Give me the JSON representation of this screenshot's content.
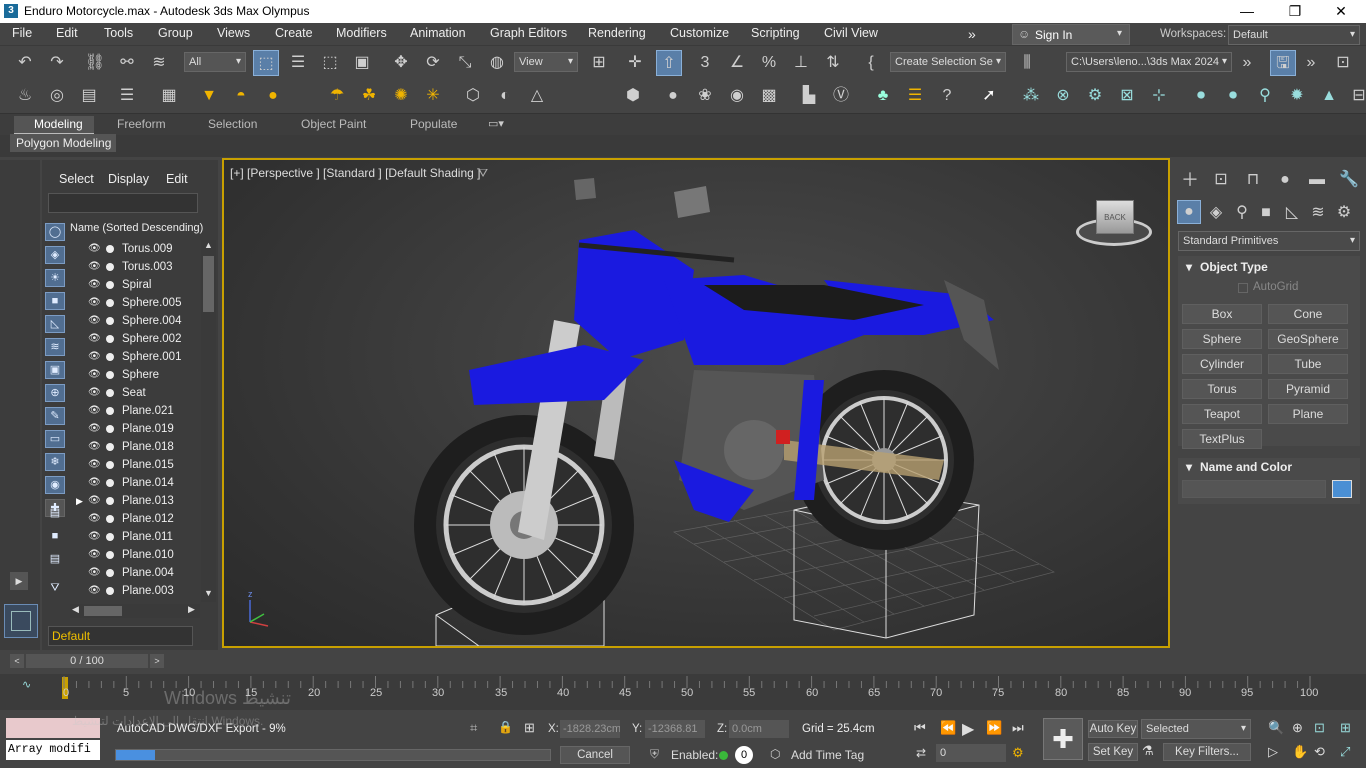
{
  "window": {
    "title": "Enduro Motorcycle.max - Autodesk 3ds Max Olympus",
    "app_icon": "3"
  },
  "menu": [
    "File",
    "Edit",
    "Tools",
    "Group",
    "Views",
    "Create",
    "Modifiers",
    "Animation",
    "Graph Editors",
    "Rendering",
    "Customize",
    "Scripting",
    "Civil View"
  ],
  "signin": {
    "label": "Sign In"
  },
  "workspaces": {
    "label": "Workspaces:",
    "value": "Default"
  },
  "toolbar": {
    "selection_filter": "All",
    "ref_coord": "View",
    "named_selection": "Create Selection Se",
    "project_path": "C:\\Users\\leno...\\3ds Max 2024"
  },
  "ribbon": {
    "tabs": [
      "Modeling",
      "Freeform",
      "Selection",
      "Object Paint",
      "Populate"
    ],
    "sub": "Polygon Modeling"
  },
  "scene_explorer": {
    "tabs": [
      "Select",
      "Display",
      "Edit"
    ],
    "column_header": "Name (Sorted Descending)",
    "items": [
      "Torus.009",
      "Torus.003",
      "Spiral",
      "Sphere.005",
      "Sphere.004",
      "Sphere.002",
      "Sphere.001",
      "Sphere",
      "Seat",
      "Plane.021",
      "Plane.019",
      "Plane.018",
      "Plane.015",
      "Plane.014",
      "Plane.013",
      "Plane.012",
      "Plane.011",
      "Plane.010",
      "Plane.004",
      "Plane.003"
    ],
    "layer": "Default"
  },
  "viewport": {
    "label": "[+] [Perspective ] [Standard ] [Default Shading ]",
    "viewcube_label": "BACK"
  },
  "command_panel": {
    "category": "Standard Primitives",
    "object_type_title": "Object Type",
    "autogrid": "AutoGrid",
    "buttons": [
      "Box",
      "Cone",
      "Sphere",
      "GeoSphere",
      "Cylinder",
      "Tube",
      "Torus",
      "Pyramid",
      "Teapot",
      "Plane",
      "TextPlus"
    ],
    "name_color_title": "Name and Color",
    "color_swatch": "#4a8fd4"
  },
  "timeline": {
    "frame": "0 / 100",
    "ticks": [
      "0",
      "5",
      "10",
      "15",
      "20",
      "25",
      "30",
      "35",
      "40",
      "45",
      "50",
      "55",
      "60",
      "65",
      "70",
      "75",
      "80",
      "85",
      "90",
      "95",
      "100"
    ]
  },
  "status": {
    "maxscript": "Array modifi",
    "progress_text": "AutoCAD DWG/DXF Export - 9%",
    "progress": 0.09,
    "cancel": "Cancel",
    "x_label": "X:",
    "x_value": "-1828.23cm",
    "y_label": "Y:",
    "y_value": "-12368.81",
    "z_label": "Z:",
    "z_value": "0.0cm",
    "grid": "Grid = 25.4cm",
    "enabled_label": "Enabled:",
    "add_time_tag": "Add Time Tag",
    "auto_key": "Auto Key",
    "set_key": "Set Key",
    "selected": "Selected",
    "key_filters": "Key Filters...",
    "frame_value": "0",
    "watermark1": "Windows تنشيط",
    "watermark2": "انتقل إلى الإعدادات لتنشيط Windows."
  },
  "colors": {
    "accent": "#c8a000",
    "bike": "#1a1ae0"
  }
}
